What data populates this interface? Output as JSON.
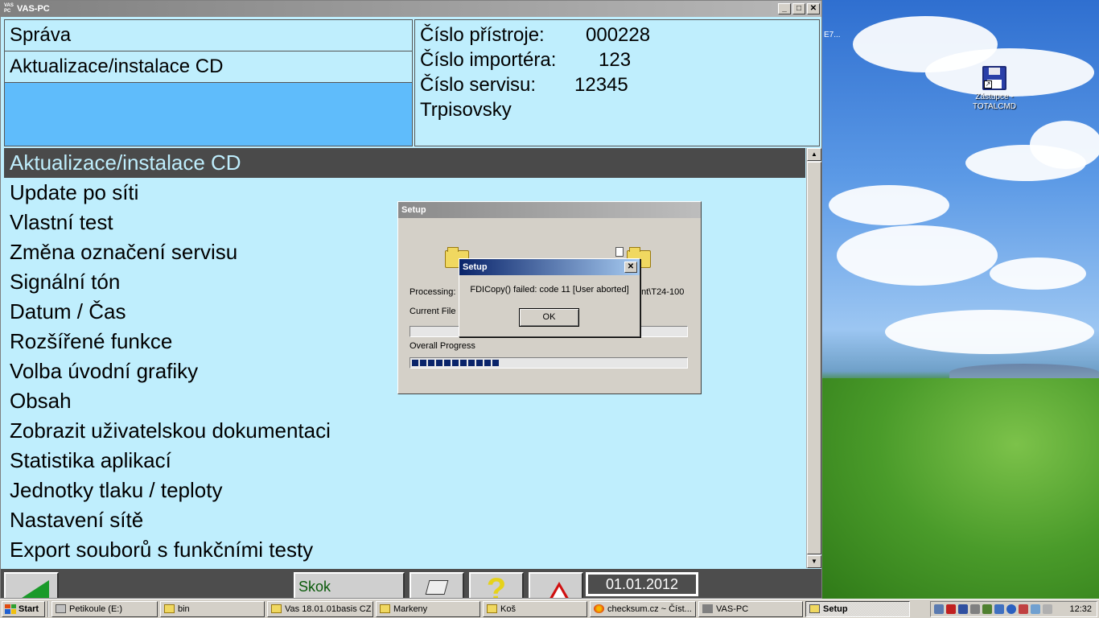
{
  "window": {
    "title": "VAS-PC",
    "app_icon_text": "VAS PC",
    "min": "_",
    "max": "□",
    "close": "✕"
  },
  "header": {
    "left": [
      "Správa",
      "Aktualizace/instalace CD"
    ],
    "right": [
      {
        "label": "Číslo přístroje:",
        "value": "000228"
      },
      {
        "label": "Číslo importéra:",
        "value": "123"
      },
      {
        "label": "Číslo servisu:",
        "value": "12345"
      },
      {
        "label": "Trpisovsky",
        "value": ""
      }
    ]
  },
  "menu": {
    "items": [
      "Aktualizace/instalace CD",
      "Update po síti",
      "Vlastní test",
      "Změna označení servisu",
      "Signální tón",
      "Datum / Čas",
      "Rozšířené funkce",
      "Volba úvodní grafiky",
      "Obsah",
      "Zobrazit uživatelskou dokumentaci",
      "Statistika aplikací",
      "Jednotky tlaku / teploty",
      "Nastavení sítě",
      "Export souborů s funkčními testy"
    ],
    "selected_index": 0
  },
  "bottom_bar": {
    "skok_label": "Skok",
    "help_label": "?",
    "date": "01.01.2012"
  },
  "setup_dialog": {
    "title": "Setup",
    "processing_label": "Processing:",
    "processing_path_tail": "ent\\T24-100",
    "current_file_label": "Current File F",
    "overall_label": "Overall Progress",
    "current_progress": 0,
    "overall_progress": 0.32
  },
  "error_dialog": {
    "title": "Setup",
    "message": "FDICopy() failed: code 11 [User aborted]",
    "ok_label": "OK",
    "close": "✕"
  },
  "desktop": {
    "icon_label_line1": "Zástupce -",
    "icon_label_line2": "TOTALCMD",
    "cut_label": "E7..."
  },
  "taskbar": {
    "start_label": "Start",
    "tasks": [
      {
        "label": "Petikoule (E:)",
        "icon": "drive-icon",
        "width": 132
      },
      {
        "label": "bin",
        "icon": "folder-icon",
        "width": 130
      },
      {
        "label": "Vas 18.01.01basis CZ",
        "icon": "folder-icon",
        "width": 132
      },
      {
        "label": "Markeny",
        "icon": "folder-icon",
        "width": 130
      },
      {
        "label": "Koš",
        "icon": "folder-icon",
        "width": 130
      },
      {
        "label": "checksum.cz ~ Číst...",
        "icon": "firefox-icon",
        "width": 132
      },
      {
        "label": "VAS-PC",
        "icon": "vas-icon",
        "width": 130
      },
      {
        "label": "Setup",
        "icon": "setup-icon",
        "width": 130,
        "active": true
      }
    ],
    "clock": "12:32"
  },
  "colors": {
    "window_bg": "#bfeefd",
    "selected_bg": "#4a4a4a",
    "header_blue": "#5fbcfb",
    "progress_fill": "#0a246a",
    "error_title": "#0a246a"
  }
}
